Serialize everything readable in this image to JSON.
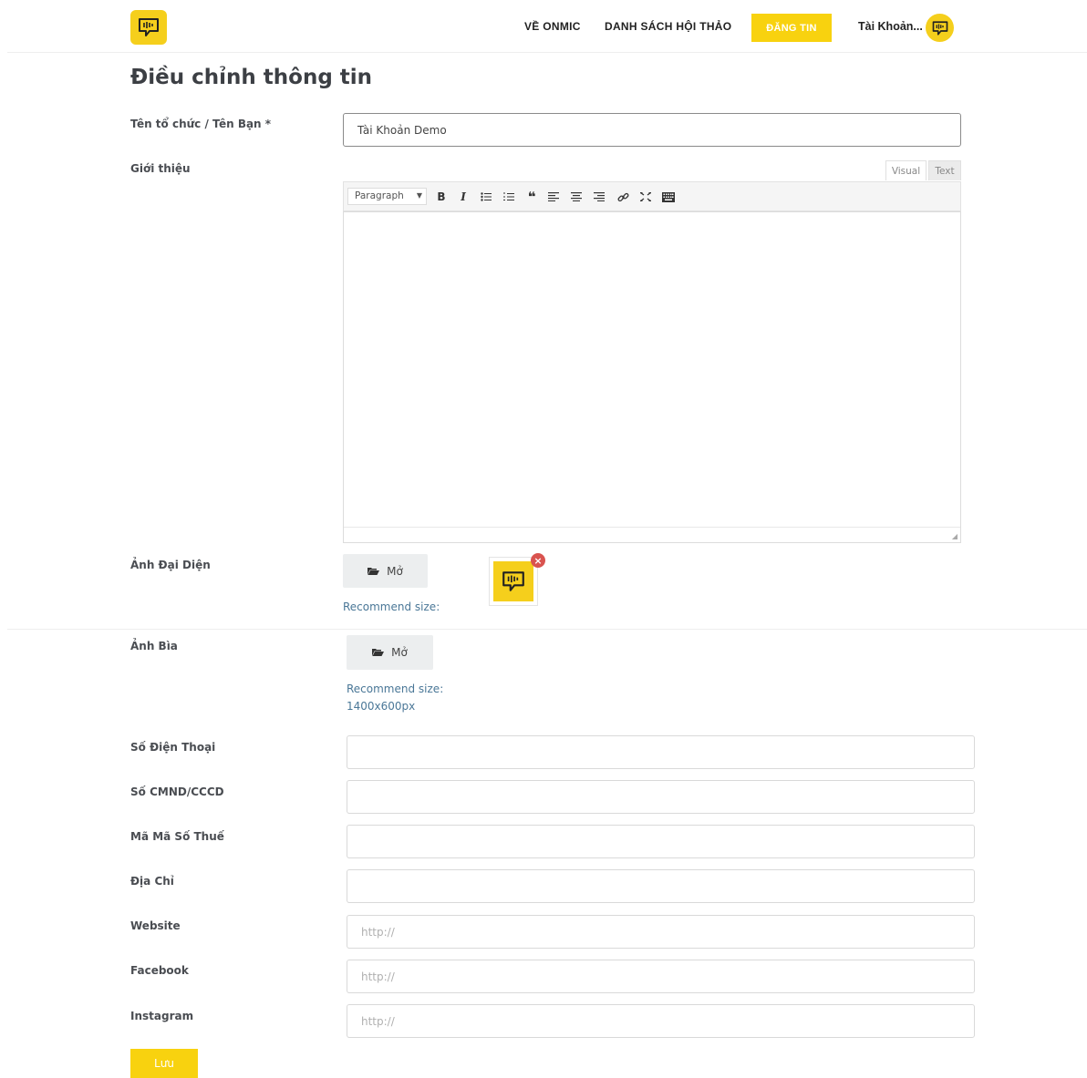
{
  "header": {
    "logo_icon": "microphone-chat-icon",
    "nav": [
      {
        "label": "VỀ ONMIC"
      },
      {
        "label": "DANH SÁCH HỘI THẢO"
      }
    ],
    "post_button": "ĐĂNG TIN",
    "account_label": "Tài Khoản...",
    "accent_color": "#f8d20f"
  },
  "page_title": "Điều chỉnh thông tin",
  "form": {
    "name": {
      "label": "Tên tổ chức / Tên Bạn *",
      "value": "Tài Khoản Demo"
    },
    "intro": {
      "label": "Giới thiệu",
      "tabs": {
        "visual": "Visual",
        "text": "Text"
      },
      "format_select": "Paragraph",
      "toolbar_icons": [
        "bold-icon",
        "italic-icon",
        "bullet-list-icon",
        "numbered-list-icon",
        "blockquote-icon",
        "align-left-icon",
        "align-center-icon",
        "align-right-icon",
        "link-icon",
        "fullscreen-icon",
        "toolbar-toggle-icon"
      ]
    },
    "avatar": {
      "label": "Ảnh Đại Diện",
      "open_button": "Mở",
      "hint": "Recommend size:"
    },
    "cover": {
      "label": "Ảnh Bìa",
      "open_button": "Mở",
      "hint_line1": "Recommend size:",
      "hint_line2": "1400x600px"
    },
    "phone": {
      "label": "Số Điện Thoại",
      "value": ""
    },
    "id_number": {
      "label": "Số CMND/CCCD",
      "value": ""
    },
    "tax_code": {
      "label": "Mã Mã Số Thuế",
      "value": ""
    },
    "address": {
      "label": "Địa Chỉ",
      "value": ""
    },
    "website": {
      "label": "Website",
      "placeholder": "http://"
    },
    "facebook": {
      "label": "Facebook",
      "placeholder": "http://"
    },
    "instagram": {
      "label": "Instagram",
      "placeholder": "http://"
    },
    "save_button": "Lưu"
  }
}
